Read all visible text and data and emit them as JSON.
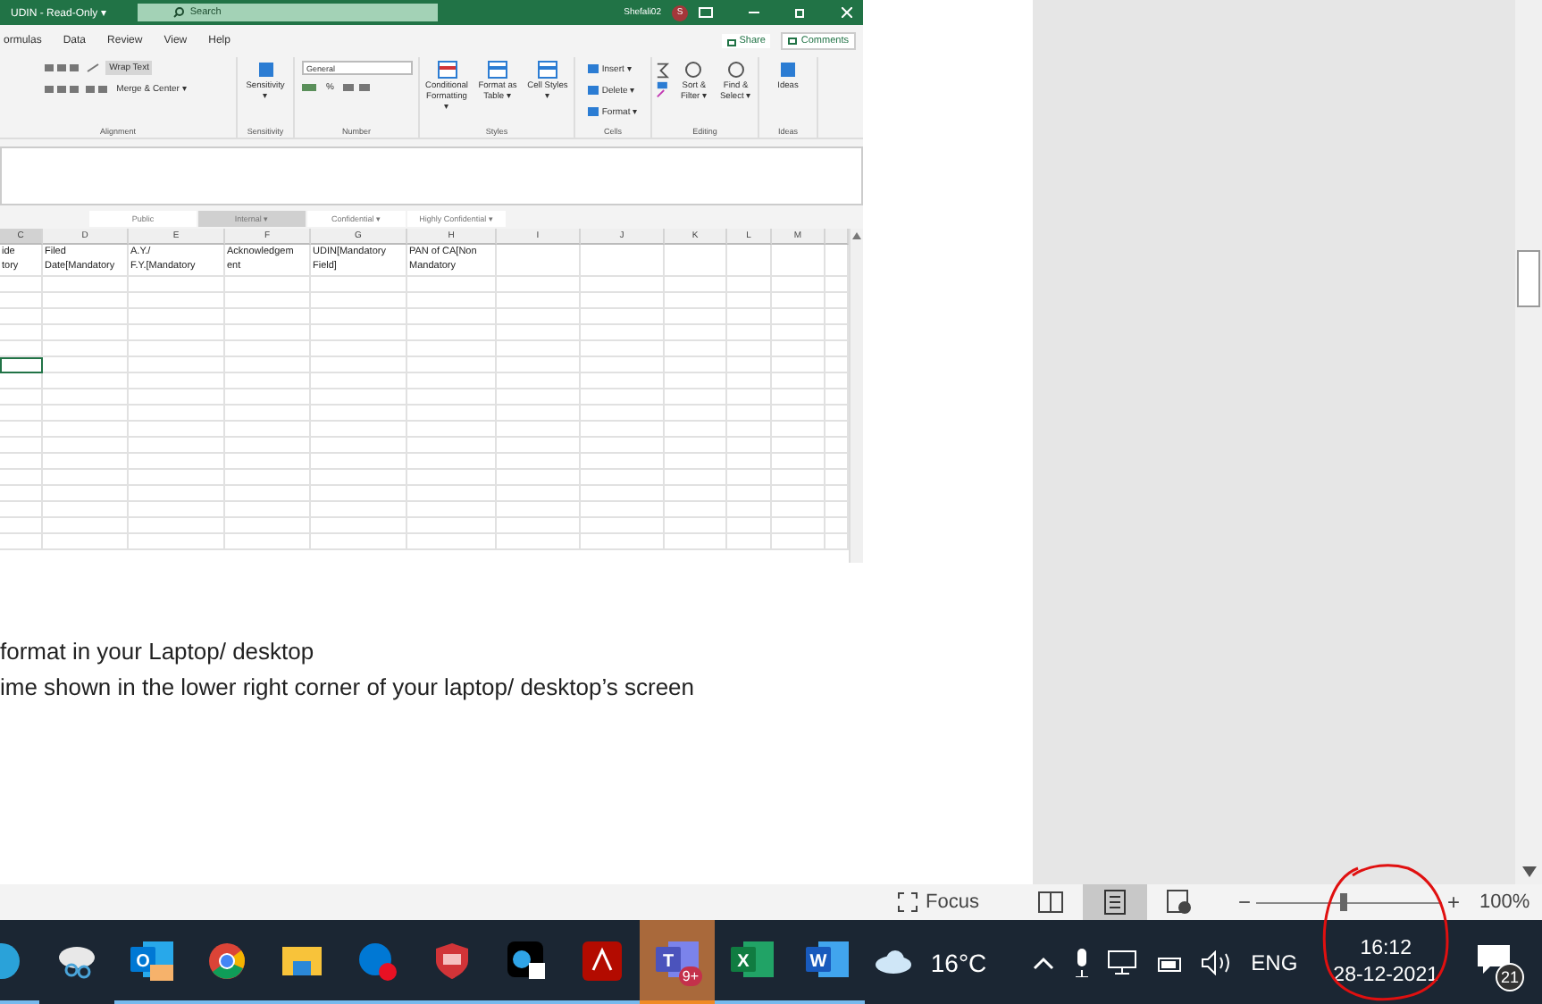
{
  "excel": {
    "title": "UDIN - Read-Only ▾",
    "search_placeholder": "Search",
    "user": "Shefali02",
    "avatar": "S",
    "menu_tabs": [
      {
        "label": "ormulas",
        "selected": false
      },
      {
        "label": "Data",
        "selected": false
      },
      {
        "label": "Review",
        "selected": false
      },
      {
        "label": "View",
        "selected": false
      },
      {
        "label": "Help",
        "selected": false
      }
    ],
    "share": "Share",
    "comments": "Comments",
    "ribbon_groups": [
      {
        "kind": "alignment",
        "label": "Alignment",
        "items": [
          "Wrap Text",
          "Merge & Center ▾"
        ]
      },
      {
        "kind": "single",
        "label": "Sensitivity",
        "items": [
          "Sensitivity ▾"
        ]
      },
      {
        "kind": "number",
        "label": "Number",
        "items": [
          "General",
          "%"
        ]
      },
      {
        "kind": "styles",
        "label": "Styles",
        "items": [
          "Conditional Formatting ▾",
          "Format as Table ▾",
          "Cell Styles ▾"
        ]
      },
      {
        "kind": "cells",
        "label": "Cells",
        "items": [
          "Insert ▾",
          "Delete ▾",
          "Format ▾"
        ]
      },
      {
        "kind": "editing",
        "label": "Editing",
        "items": [
          "Sort & Filter ▾",
          "Find & Select ▾"
        ]
      },
      {
        "kind": "single",
        "label": "Ideas",
        "items": [
          "Ideas"
        ]
      }
    ],
    "classification": [
      {
        "label": "Public",
        "selected": false
      },
      {
        "label": "Internal ▾",
        "selected": true
      },
      {
        "label": "Confidential ▾",
        "selected": false
      },
      {
        "label": "Highly Confidential ▾",
        "selected": false
      }
    ],
    "columns": [
      {
        "label": "C",
        "selected": true
      },
      {
        "label": "D",
        "selected": false
      },
      {
        "label": "E",
        "selected": false
      },
      {
        "label": "F",
        "selected": false
      },
      {
        "label": "G",
        "selected": false
      },
      {
        "label": "H",
        "selected": false
      },
      {
        "label": "I",
        "selected": false
      },
      {
        "label": "J",
        "selected": false
      },
      {
        "label": "K",
        "selected": false
      },
      {
        "label": "L",
        "selected": false
      },
      {
        "label": "M",
        "selected": false
      }
    ],
    "header_row": [
      "ide\ntory",
      "Filed\nDate[Mandatory",
      "A.Y./\nF.Y.[Mandatory",
      "Acknowledgem\nent",
      "UDIN[Mandatory\nField]",
      "PAN of CA[Non\nMandatory"
    ],
    "empty_rows": [
      {
        "selected": false
      },
      {
        "selected": false
      },
      {
        "selected": false
      },
      {
        "selected": false
      },
      {
        "selected": false
      },
      {
        "selected": true
      },
      {
        "selected": false
      },
      {
        "selected": false
      },
      {
        "selected": false
      },
      {
        "selected": false
      },
      {
        "selected": false
      },
      {
        "selected": false
      },
      {
        "selected": false
      },
      {
        "selected": false
      },
      {
        "selected": false
      },
      {
        "selected": false
      },
      {
        "selected": false
      }
    ]
  },
  "document_lines": [
    "format in your Laptop/ desktop",
    "ime shown in the lower right corner of your laptop/ desktop’s screen"
  ],
  "status_bar": {
    "focus": "Focus",
    "views": [
      {
        "kind": "read",
        "selected": false
      },
      {
        "kind": "print",
        "selected": true
      },
      {
        "kind": "web",
        "selected": false
      }
    ],
    "zoom_out": "−",
    "zoom_in": "+",
    "zoom": {
      "level": 0.47
    },
    "zoom_text": "100%"
  },
  "taskbar": {
    "apps": [
      {
        "kind": "edge",
        "open": true,
        "selected": false
      },
      {
        "kind": "snip",
        "open": false,
        "selected": false
      },
      {
        "kind": "outlook",
        "letter": "O",
        "open": true,
        "selected": false
      },
      {
        "kind": "chrome",
        "open": true,
        "selected": false
      },
      {
        "kind": "folder",
        "open": true,
        "selected": false
      },
      {
        "kind": "skype",
        "open": true,
        "selected": false
      },
      {
        "kind": "shield",
        "open": true,
        "selected": false
      },
      {
        "kind": "webex",
        "open": true,
        "selected": false
      },
      {
        "kind": "acrobat",
        "open": true,
        "selected": false
      },
      {
        "kind": "teams",
        "letter": "T",
        "badge": "9+",
        "open": true,
        "selected": true
      },
      {
        "kind": "excel",
        "letter": "X",
        "open": true,
        "selected": false
      },
      {
        "kind": "word",
        "letter": "W",
        "open": true,
        "selected": false
      }
    ],
    "temperature": "16°C",
    "language": "ENG",
    "time": "16:12",
    "date": "28-12-2021",
    "notifications": "21"
  },
  "annotation": {
    "kind": "circle"
  }
}
